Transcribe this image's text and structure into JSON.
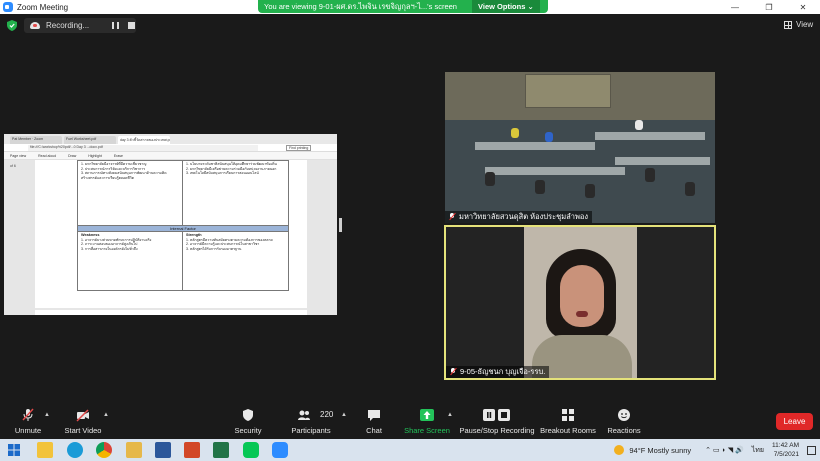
{
  "window": {
    "title": "Zoom Meeting",
    "controls": {
      "minimize": "—",
      "maximize": "❐",
      "close": "✕"
    }
  },
  "share_banner": {
    "message": "You are viewing 9-01-ผศ.ดร.ไพจิน เรขจิญกุลฯ-ไ...'s screen",
    "view_options": "View Options ⌄"
  },
  "recording": {
    "label": "Recording..."
  },
  "view_button": {
    "label": "View"
  },
  "shared_screen": {
    "tabs": [
      "Pat Member · Zoom",
      "Fuel Worksheet.pdf",
      "day 3 ตัวชี้วัดสากลของประเทศ.pdf"
    ],
    "url": "file:///C:/workshop%20pdf/...0 Day 3 ...docx.pdf",
    "toolbar_items": [
      "Page view",
      "Read aloud",
      "Draw",
      "Highlight",
      "Erase"
    ],
    "find_button": "Find printing",
    "sidebar_label": "of 6",
    "table": {
      "top_left_items": [
        "1. มหาวิทยาลัยมีอาจารย์ที่มีความเชี่ยวชาญ",
        "2. ประสบการณ์การวิจัยและบริการวิชาการ",
        "3. สถานการณ์ทางสังคมสนับสนุนการพัฒนาด้านความคิดสร้างสรรค์และการเรียนรู้ตลอดชีวิต"
      ],
      "top_right_items": [
        "1. นโยบายระดับชาติสนับสนุนให้อุดมศึกษาร่วมพัฒนาท้องถิ่น",
        "2. มหาวิทยาลัยมีเครือข่ายความร่วมมือกับหน่วยงานภายนอก",
        "3. เทคโนโลยีสนับสนุนการเรียนการสอนออนไลน์"
      ],
      "section_header": "Internal Factor",
      "weakness_label": "Weakness",
      "strength_label": "Strength",
      "weakness_items": [
        "1. อาจารย์บางส่วนขาดทักษะการปฏิบัติงานจริง",
        "2. ภาระงานสอนของอาจารย์สูงเกินไป",
        "3. การสื่อสารภายในองค์กรยังไม่ทั่วถึง"
      ],
      "strength_items": [
        "1. หลักสูตรมีความทันสมัยตรงตามความต้องการของตลาด",
        "2. อาจารย์มีความรู้และประสบการณ์ในสาขาวิชา",
        "3. หลักสูตรได้รับการรับรองมาตรฐาน"
      ]
    }
  },
  "participants": [
    {
      "name": "มหาวิทยาลัยสวนดุสิต ห้องประชุมลำพอง",
      "muted": true
    },
    {
      "name": "9-05-ธัญชนก บุญเจือ-รรบ.",
      "muted": true,
      "active_speaker": true
    }
  ],
  "controls": {
    "unmute": "Unmute",
    "start_video": "Start Video",
    "security": "Security",
    "participants": "Participants",
    "participants_count": "220",
    "chat": "Chat",
    "share_screen": "Share Screen",
    "pause_stop_recording": "Pause/Stop Recording",
    "breakout_rooms": "Breakout Rooms",
    "reactions": "Reactions",
    "leave": "Leave"
  },
  "taskbar": {
    "weather": "94°F  Mostly sunny",
    "language": "ไทย",
    "time": "11:42 AM",
    "date": "7/5/2021"
  },
  "colors": {
    "banner_green": "#23b14d",
    "active_speaker_border": "#e4e27a",
    "leave_red": "#e02828",
    "share_green": "#23c35a"
  }
}
